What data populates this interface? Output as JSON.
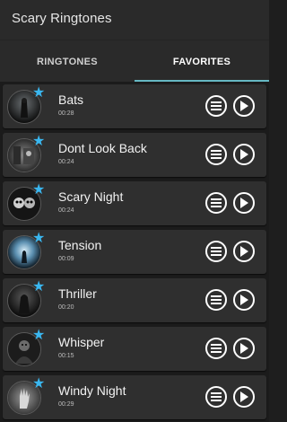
{
  "app": {
    "title": "Scary Ringtones"
  },
  "tabs": [
    {
      "label": "RINGTONES",
      "active": false
    },
    {
      "label": "FAVORITES",
      "active": true
    }
  ],
  "colors": {
    "accent": "#66b8c3",
    "star": "#3ab7f0"
  },
  "ringtones": [
    {
      "name": "Bats",
      "duration": "00:28",
      "favorite": true,
      "thumb_icon": "bats-thumbnail"
    },
    {
      "name": "Dont Look Back",
      "duration": "00:24",
      "favorite": true,
      "thumb_icon": "dont-look-back-thumbnail"
    },
    {
      "name": "Scary Night",
      "duration": "00:24",
      "favorite": true,
      "thumb_icon": "scary-night-thumbnail"
    },
    {
      "name": "Tension",
      "duration": "00:09",
      "favorite": true,
      "thumb_icon": "tension-thumbnail"
    },
    {
      "name": "Thriller",
      "duration": "00:20",
      "favorite": true,
      "thumb_icon": "thriller-thumbnail"
    },
    {
      "name": "Whisper",
      "duration": "00:15",
      "favorite": true,
      "thumb_icon": "whisper-thumbnail"
    },
    {
      "name": "Windy Night",
      "duration": "00:29",
      "favorite": true,
      "thumb_icon": "windy-night-thumbnail"
    }
  ],
  "icons": {
    "favorite": "star-icon",
    "options": "menu-icon",
    "play": "play-icon"
  }
}
